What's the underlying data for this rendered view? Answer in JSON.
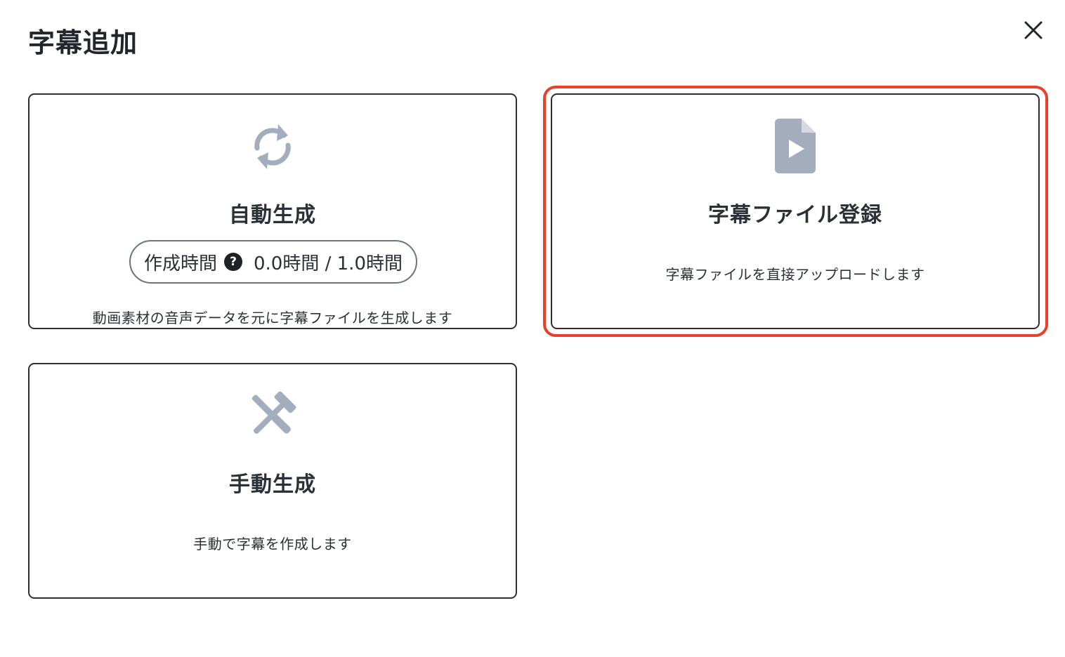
{
  "dialog": {
    "title": "字幕追加"
  },
  "cards": {
    "auto": {
      "icon": "refresh-icon",
      "title": "自動生成",
      "time_label": "作成時間",
      "time_value": "0.0時間 / 1.0時間",
      "description": "動画素材の音声データを元に字幕ファイルを生成します"
    },
    "upload": {
      "icon": "file-video-icon",
      "title": "字幕ファイル登録",
      "description": "字幕ファイルを直接アップロードします"
    },
    "manual": {
      "icon": "tools-icon",
      "title": "手動生成",
      "description": "手動で字幕を作成します"
    }
  },
  "help_icon_glyph": "?",
  "colors": {
    "icon_gray": "#a3adbd",
    "border": "#2b2f36",
    "highlight": "#e8402a"
  }
}
